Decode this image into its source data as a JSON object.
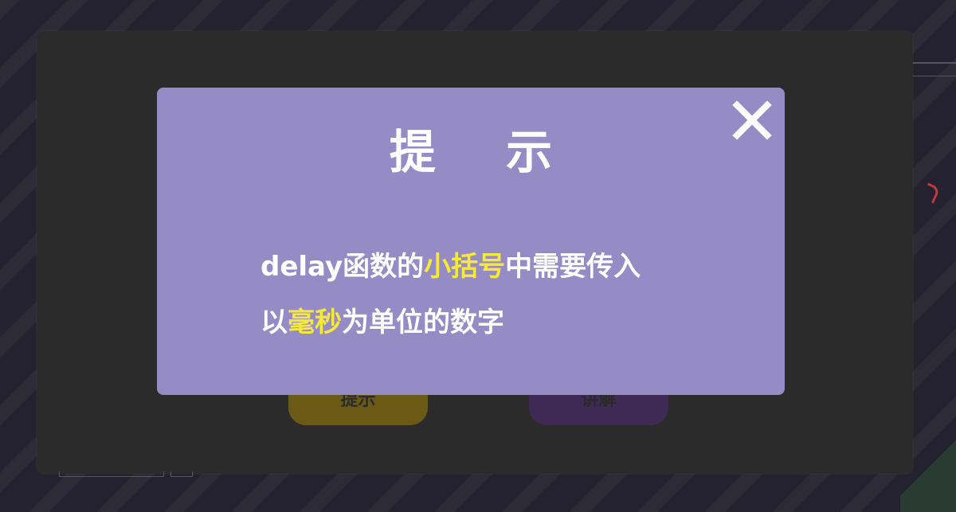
{
  "background": {
    "title": "",
    "buttons": {
      "hint_label": "提示",
      "explain_label": "讲解"
    }
  },
  "modal": {
    "title": "提 示",
    "close_icon": "close-icon",
    "line1": {
      "a": "delay函数的",
      "b": "小括号",
      "c": "中需要传入"
    },
    "line2": {
      "a": "以",
      "b": "毫秒",
      "c": "为单位的数字"
    },
    "highlight_color": "#f6e93a",
    "background_color": "#958cc6"
  }
}
